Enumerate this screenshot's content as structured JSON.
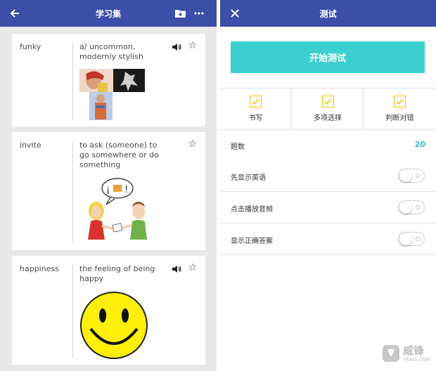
{
  "left": {
    "title": "学习集",
    "icons": {
      "back": "arrow-left-icon",
      "add_folder": "folder-plus-icon",
      "more": "more-horizontal-icon"
    },
    "cards": [
      {
        "term": "funky",
        "definition": "a/ uncommon, modernly stylish",
        "has_audio": true,
        "image": "fashion-photos"
      },
      {
        "term": "invite",
        "definition": "to ask (someone) to go somewhere or do something",
        "has_audio": false,
        "image": "invitation-cartoon"
      },
      {
        "term": "happiness",
        "definition": "the feeling of being happy",
        "has_audio": true,
        "image": "smiley-face"
      }
    ]
  },
  "right": {
    "title": "测试",
    "close_icon": "close-icon",
    "start_button": "开始测试",
    "modes": [
      {
        "label": "书写",
        "checked": true
      },
      {
        "label": "多项选择",
        "checked": true
      },
      {
        "label": "判断对错",
        "checked": true
      }
    ],
    "question_count": {
      "label": "题数",
      "value": "20"
    },
    "settings": [
      {
        "label": "先显示英语",
        "on": false
      },
      {
        "label": "点击播放音频",
        "on": false
      },
      {
        "label": "显示正确答案",
        "on": false
      }
    ]
  },
  "watermark": {
    "name": "威锋",
    "url": "FENG.COM"
  },
  "colors": {
    "appbar": "#3b4ea8",
    "accent": "#3ccfcf",
    "checkbox": "#f2c200",
    "count": "#2fb8c9",
    "background": "#e8e8e8"
  }
}
